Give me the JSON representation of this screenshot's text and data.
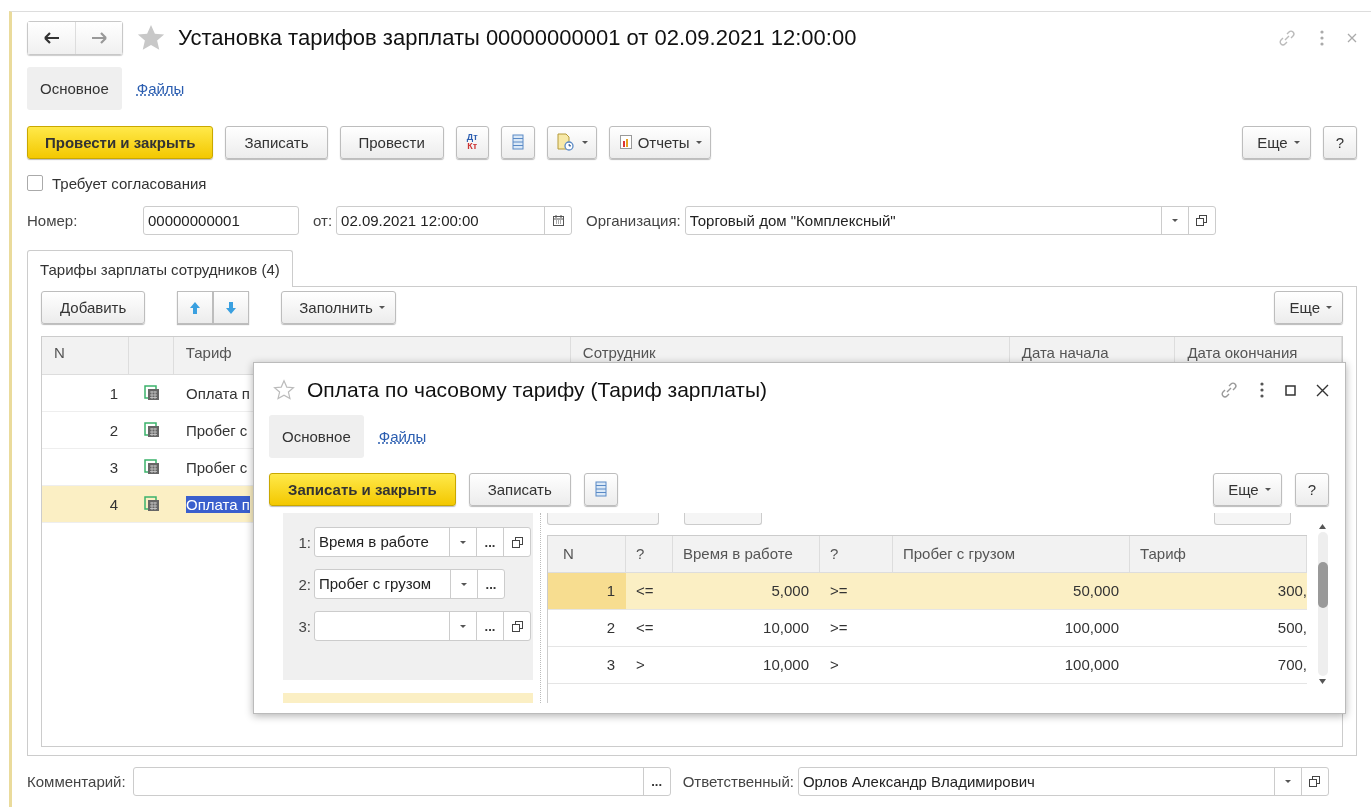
{
  "window": {
    "title": "Установка тарифов зарплаты 00000000001 от 02.09.2021 12:00:00"
  },
  "nav_tabs": [
    {
      "label": "Основное",
      "selected": true
    },
    {
      "label": "Файлы",
      "selected": false
    }
  ],
  "toolbar": {
    "primary": "Провести и закрыть",
    "buttons": [
      "Записать",
      "Провести"
    ],
    "dt": "Дт",
    "kt": "Кт",
    "reports": "Отчеты",
    "more": "Еще",
    "help": "?"
  },
  "approval": {
    "label": "Требует согласования",
    "checked": false
  },
  "number": {
    "label": "Номер:",
    "value": "00000000001"
  },
  "date": {
    "label": "от:",
    "value": "02.09.2021 12:00:00"
  },
  "organization": {
    "label": "Организация:",
    "value": "Торговый дом \"Комплексный\""
  },
  "section_tabs": [
    {
      "label": "Тарифы зарплаты сотрудников (4)",
      "selected": true
    }
  ],
  "table_toolbar": {
    "add": "Добавить",
    "fill": "Заполнить",
    "more": "Еще"
  },
  "table": {
    "columns": [
      "N",
      "Тариф",
      "Сотрудник",
      "Дата начала",
      "Дата окончания"
    ],
    "rows": [
      {
        "n": "1",
        "tariff": "Оплата п",
        "selected": false
      },
      {
        "n": "2",
        "tariff": "Пробег с",
        "selected": false
      },
      {
        "n": "3",
        "tariff": "Пробег с",
        "selected": false
      },
      {
        "n": "4",
        "tariff": "Оплата п",
        "selected": true
      }
    ]
  },
  "comment": {
    "label": "Комментарий:",
    "select_button": "..."
  },
  "responsible": {
    "label": "Ответственный:",
    "value": "Орлов Александр Владимирович"
  },
  "dialog": {
    "title": "Оплата по часовому тарифу (Тариф зарплаты)",
    "tabs": [
      {
        "label": "Основное",
        "selected": true
      },
      {
        "label": "Файлы",
        "selected": false
      }
    ],
    "toolbar": {
      "primary": "Записать и закрыть",
      "save": "Записать",
      "more": "Еще",
      "help": "?"
    },
    "parameters": [
      {
        "label": "1:",
        "value": "Время в работе",
        "select_button": "...",
        "open_button": true
      },
      {
        "label": "2:",
        "value": "Пробег с грузом",
        "select_button": "...",
        "open_button": false
      },
      {
        "label": "3:",
        "select_button": "...",
        "open_button": true
      }
    ],
    "grid": {
      "columns": [
        "N",
        "?",
        "Время в работе",
        "?",
        "Пробег с грузом",
        "Тариф"
      ],
      "rows": [
        {
          "n": "1",
          "op1": "<=",
          "v1": "5,000",
          "op2": ">=",
          "v2": "50,000",
          "tariff": "300,",
          "selected": true
        },
        {
          "n": "2",
          "op1": "<=",
          "v1": "10,000",
          "op2": ">=",
          "v2": "100,000",
          "tariff": "500,",
          "selected": false
        },
        {
          "n": "3",
          "op1": ">",
          "v1": "10,000",
          "op2": ">",
          "v2": "100,000",
          "tariff": "700,",
          "selected": false
        }
      ]
    }
  }
}
